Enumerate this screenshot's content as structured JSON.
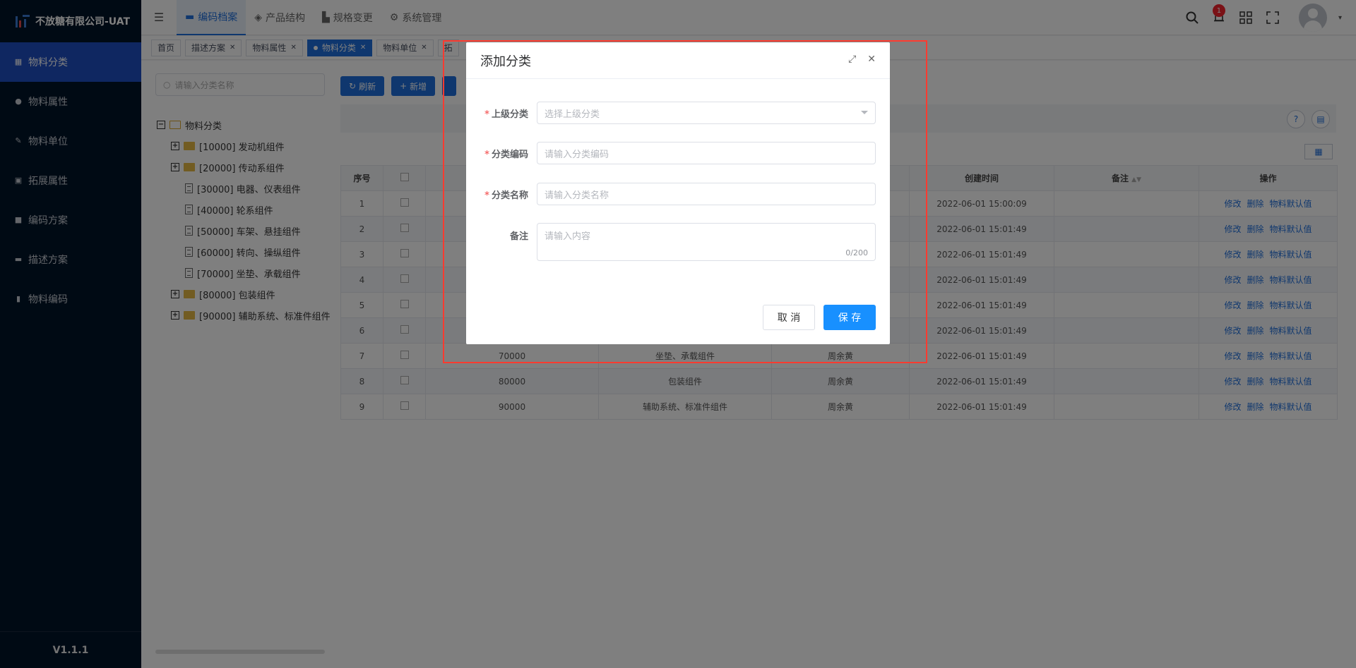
{
  "app": {
    "title": "不放糖有限公司-UAT",
    "version": "V1.1.1"
  },
  "sidebar": {
    "items": [
      {
        "label": "物料分类",
        "icon": "grid-icon"
      },
      {
        "label": "物料属性",
        "icon": "info-icon"
      },
      {
        "label": "物料单位",
        "icon": "ruler-icon"
      },
      {
        "label": "拓展属性",
        "icon": "image-icon"
      },
      {
        "label": "编码方案",
        "icon": "book-icon"
      },
      {
        "label": "描述方案",
        "icon": "file-icon"
      },
      {
        "label": "物料编码",
        "icon": "doc-icon"
      }
    ]
  },
  "header": {
    "nav": [
      {
        "label": "编码档案"
      },
      {
        "label": "产品结构"
      },
      {
        "label": "规格变更"
      },
      {
        "label": "系统管理"
      }
    ],
    "bell_badge": "1"
  },
  "tags": [
    "首页",
    "描述方案",
    "物料属性",
    "物料分类",
    "物料单位",
    "拓"
  ],
  "left": {
    "search_placeholder": "请输入分类名称",
    "tree_root": "物料分类",
    "tree": [
      "[10000] 发动机组件",
      "[20000] 传动系组件",
      "[30000] 电器、仪表组件",
      "[40000] 轮系组件",
      "[50000] 车架、悬挂组件",
      "[60000] 转向、操纵组件",
      "[70000] 坐垫、承载组件",
      "[80000] 包装组件",
      "[90000] 辅助系统、标准件组件"
    ]
  },
  "toolbar": {
    "refresh": "刷新",
    "add": "新增"
  },
  "table": {
    "headers": {
      "index": "序号",
      "created": "创建时间",
      "remark": "备注",
      "ops": "操作"
    },
    "ops": {
      "edit": "修改",
      "delete": "删除",
      "default": "物料默认值"
    },
    "rows": [
      {
        "no": "1",
        "code": "",
        "name": "",
        "user": "",
        "created": "2022-06-01 15:00:09"
      },
      {
        "no": "2",
        "code": "",
        "name": "",
        "user": "",
        "created": "2022-06-01 15:01:49"
      },
      {
        "no": "3",
        "code": "",
        "name": "",
        "user": "",
        "created": "2022-06-01 15:01:49"
      },
      {
        "no": "4",
        "code": "",
        "name": "",
        "user": "",
        "created": "2022-06-01 15:01:49"
      },
      {
        "no": "5",
        "code": "",
        "name": "",
        "user": "",
        "created": "2022-06-01 15:01:49"
      },
      {
        "no": "6",
        "code": "",
        "name": "",
        "user": "",
        "created": "2022-06-01 15:01:49"
      },
      {
        "no": "7",
        "code": "70000",
        "name": "坐垫、承载组件",
        "user": "周余黄",
        "created": "2022-06-01 15:01:49"
      },
      {
        "no": "8",
        "code": "80000",
        "name": "包装组件",
        "user": "周余黄",
        "created": "2022-06-01 15:01:49"
      },
      {
        "no": "9",
        "code": "90000",
        "name": "辅助系统、标准件组件",
        "user": "周余黄",
        "created": "2022-06-01 15:01:49"
      }
    ]
  },
  "dialog": {
    "title": "添加分类",
    "parent_label": "上级分类",
    "parent_placeholder": "选择上级分类",
    "code_label": "分类编码",
    "code_placeholder": "请输入分类编码",
    "name_label": "分类名称",
    "name_placeholder": "请输入分类名称",
    "remark_label": "备注",
    "remark_placeholder": "请输入内容",
    "counter": "0/200",
    "cancel": "取 消",
    "save": "保 存"
  },
  "colors": {
    "primary": "#1f6fdc",
    "sidebar": "#001529",
    "highlight": "#ff3b30",
    "save": "#1890ff"
  }
}
